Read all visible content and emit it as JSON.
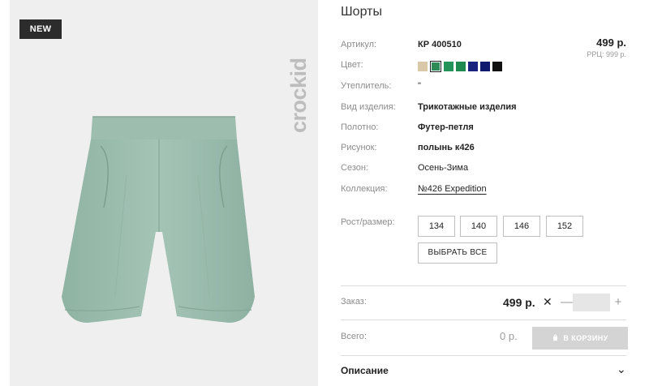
{
  "image": {
    "badge": "NEW",
    "brand": "crockid"
  },
  "product": {
    "title": "Шорты",
    "price": "499 р.",
    "rrp": "РРЦ: 999 р.",
    "specs": [
      {
        "label": "Артикул:",
        "value": "КР 400510"
      },
      {
        "label": "Цвет:",
        "value": ""
      },
      {
        "label": "Утеплитель:",
        "value": "\""
      },
      {
        "label": "Вид изделия:",
        "value": "Трикотажные изделия"
      },
      {
        "label": "Полотно:",
        "value": "Футер-петля"
      },
      {
        "label": "Рисунок:",
        "value": "полынь к426"
      },
      {
        "label": "Сезон:",
        "value": "Осень-Зима"
      },
      {
        "label": "Коллекция:",
        "value": "№426 Expedition"
      }
    ],
    "colors": [
      "#d9c9a8",
      "#2e8b57",
      "#23935a",
      "#1e8a50",
      "#1a237e",
      "#0d1a6e",
      "#111111"
    ],
    "selected_color_index": 1,
    "size_label": "Рост/размер:",
    "sizes": [
      "134",
      "140",
      "146",
      "152"
    ],
    "select_all": "ВЫБРАТЬ ВСЕ"
  },
  "order": {
    "label": "Заказ:",
    "unit_price": "499 р.",
    "times": "✕",
    "minus": "—",
    "plus": "+",
    "quantity": ""
  },
  "total": {
    "label": "Всего:",
    "value": "0 р.",
    "cart_button": "В КОРЗИНУ"
  },
  "description": {
    "label": "Описание",
    "chevron": "⌄"
  },
  "colors_ui": {
    "accent": "#222222",
    "muted": "#8c8c8c",
    "disabled": "#d4d4d4"
  }
}
